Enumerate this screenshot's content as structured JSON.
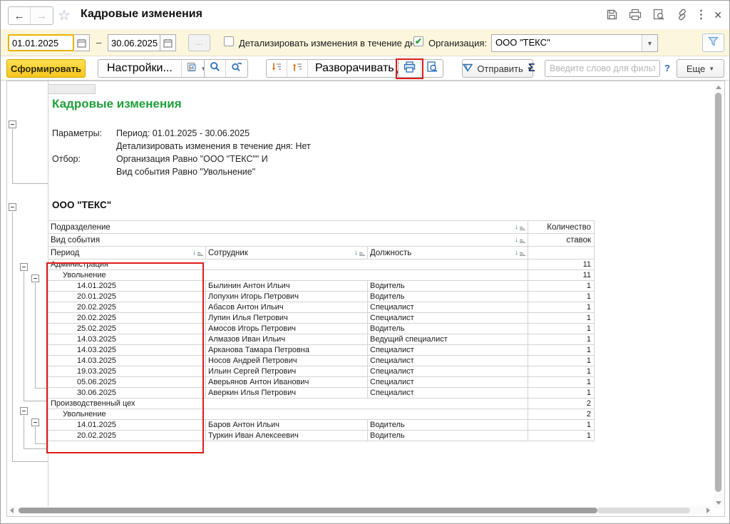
{
  "window": {
    "title": "Кадровые изменения"
  },
  "titlebar": {
    "icons": [
      "back-icon",
      "forward-icon",
      "favorite-star-icon",
      "save-icon",
      "print-icon",
      "preview-icon",
      "link-icon",
      "more-menu-icon",
      "close-icon"
    ]
  },
  "filterbar": {
    "date_from": "01.01.2025",
    "date_to": "30.06.2025",
    "dash": "–",
    "more_dates_button": "...",
    "detail_checkbox_label": "Детализировать изменения в течение дня",
    "org_checkbox_label": "Организация:",
    "org_value": "ООО \"ТЕКС\""
  },
  "toolbar": {
    "generate_label": "Сформировать",
    "settings_label": "Настройки...",
    "expand_to_label": "Разворачивать до",
    "send_label": "Отправить",
    "sigma": "Σ",
    "filter_placeholder": "Введите слово для фильтра ...",
    "help": "?",
    "more_label": "Еще"
  },
  "report": {
    "title": "Кадровые изменения",
    "params_label": "Параметры:",
    "params_line1": "Период: 01.01.2025 - 30.06.2025",
    "params_line2": "Детализировать изменения в течение дня: Нет",
    "filter_label": "Отбор:",
    "filter_line1": "Организация Равно \"ООО \"ТЕКС\"\" И",
    "filter_line2": "Вид события Равно \"Увольнение\"",
    "org_header": "ООО \"ТЕКС\""
  },
  "table": {
    "headers": {
      "group1": "Подразделение",
      "group2": "Вид события",
      "period": "Период",
      "employee": "Сотрудник",
      "position": "Должность",
      "count_line1": "Количество",
      "count_line2": "ставок"
    },
    "rows": [
      {
        "level": 1,
        "period": "Администрация",
        "employee": "",
        "position": "",
        "count": "11"
      },
      {
        "level": 2,
        "period": "Увольнение",
        "employee": "",
        "position": "",
        "count": "11"
      },
      {
        "level": 3,
        "period": "14.01.2025",
        "employee": "Былинин Антон Ильич",
        "position": "Водитель",
        "count": "1"
      },
      {
        "level": 3,
        "period": "20.01.2025",
        "employee": "Лопухин Игорь Петрович",
        "position": "Водитель",
        "count": "1"
      },
      {
        "level": 3,
        "period": "20.02.2025",
        "employee": "Абасов Антон Ильич",
        "position": "Специалист",
        "count": "1"
      },
      {
        "level": 3,
        "period": "20.02.2025",
        "employee": "Лупин Илья Петрович",
        "position": "Специалист",
        "count": "1"
      },
      {
        "level": 3,
        "period": "25.02.2025",
        "employee": "Амосов Игорь Петрович",
        "position": "Водитель",
        "count": "1"
      },
      {
        "level": 3,
        "period": "14.03.2025",
        "employee": "Алмазов Иван Ильич",
        "position": "Ведущий специалист",
        "count": "1"
      },
      {
        "level": 3,
        "period": "14.03.2025",
        "employee": "Арканова Тамара Петровна",
        "position": "Специалист",
        "count": "1"
      },
      {
        "level": 3,
        "period": "14.03.2025",
        "employee": "Носов Андрей Петрович",
        "position": "Специалист",
        "count": "1"
      },
      {
        "level": 3,
        "period": "19.03.2025",
        "employee": "Ильин Сергей Петрович",
        "position": "Специалист",
        "count": "1"
      },
      {
        "level": 3,
        "period": "05.06.2025",
        "employee": "Аверьянов Антон Иванович",
        "position": "Специалист",
        "count": "1"
      },
      {
        "level": 3,
        "period": "30.06.2025",
        "employee": "Аверкин Илья Петрович",
        "position": "Специалист",
        "count": "1"
      },
      {
        "level": 1,
        "period": "Производственный цех",
        "employee": "",
        "position": "",
        "count": "2"
      },
      {
        "level": 2,
        "period": "Увольнение",
        "employee": "",
        "position": "",
        "count": "2"
      },
      {
        "level": 3,
        "period": "14.01.2025",
        "employee": "Баров Антон Ильич",
        "position": "Водитель",
        "count": "1"
      },
      {
        "level": 3,
        "period": "20.02.2025",
        "employee": "Туркин Иван Алексеевич",
        "position": "Водитель",
        "count": "1"
      }
    ]
  },
  "colors": {
    "accent_yellow": "#f6c51e",
    "report_title_green": "#1fa03c",
    "annotation_red": "#e01b1b",
    "toolbar_icon_blue": "#2a6fb7",
    "filterbar_cream": "#fbf6dc"
  }
}
